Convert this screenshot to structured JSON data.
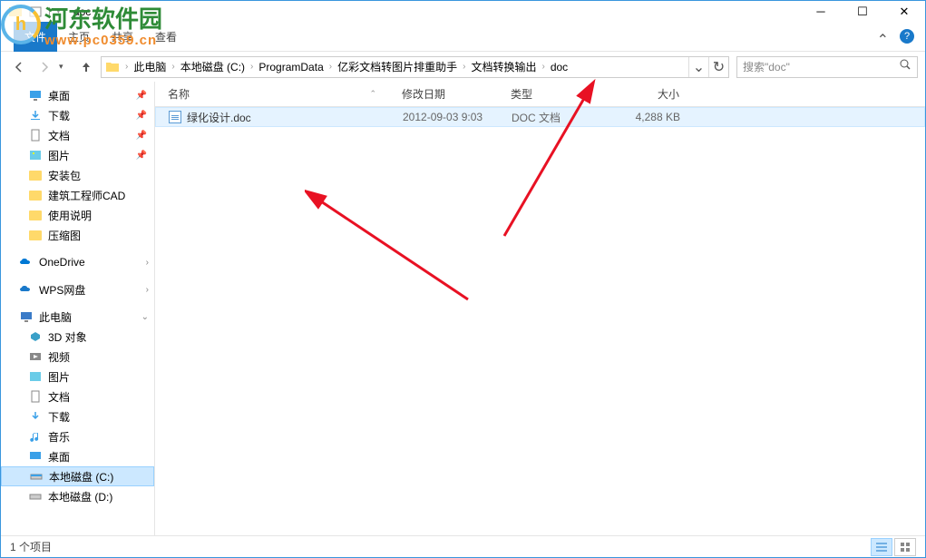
{
  "window": {
    "title": "doc"
  },
  "ribbon": {
    "file_tab": "文件",
    "home_tab": "主页",
    "share_tab": "共享",
    "view_tab": "查看"
  },
  "breadcrumb": {
    "items": [
      "此电脑",
      "本地磁盘 (C:)",
      "ProgramData",
      "亿彩文档转图片排重助手",
      "文档转换输出",
      "doc"
    ]
  },
  "search": {
    "placeholder": "搜索\"doc\""
  },
  "sidebar": {
    "desktop": "桌面",
    "downloads": "下载",
    "documents": "文档",
    "pictures": "图片",
    "install_pkg": "安装包",
    "arch_cad": "建筑工程师CAD",
    "usage": "使用说明",
    "thumbnails": "压缩图",
    "onedrive": "OneDrive",
    "wps": "WPS网盘",
    "thispc": "此电脑",
    "objects3d": "3D 对象",
    "videos": "视频",
    "pictures2": "图片",
    "documents2": "文档",
    "downloads2": "下载",
    "music": "音乐",
    "desktop2": "桌面",
    "localc": "本地磁盘 (C:)",
    "locald": "本地磁盘 (D:)"
  },
  "columns": {
    "name": "名称",
    "date": "修改日期",
    "type": "类型",
    "size": "大小"
  },
  "files": [
    {
      "name": "绿化设计.doc",
      "date": "2012-09-03 9:03",
      "type": "DOC 文档",
      "size": "4,288 KB"
    }
  ],
  "status": {
    "count": "1 个项目"
  },
  "watermark": {
    "name": "河东软件园",
    "url": "www.pc0359.cn"
  }
}
